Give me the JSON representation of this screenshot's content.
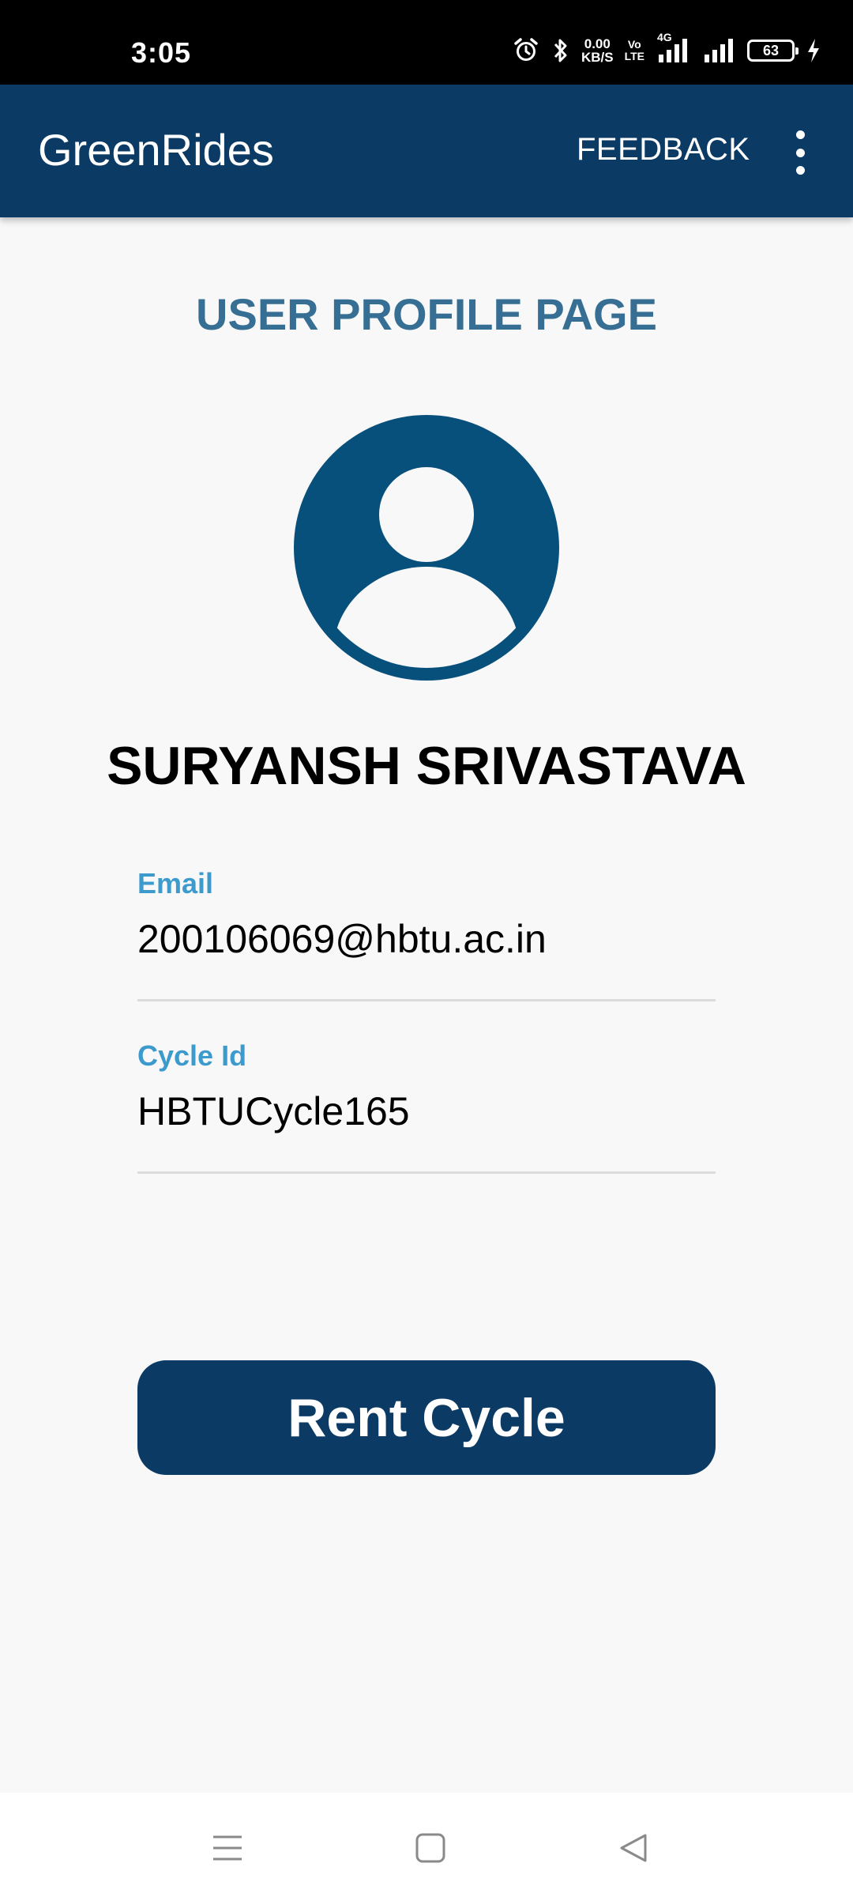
{
  "status_bar": {
    "time": "3:05",
    "net_speed_value": "0.00",
    "net_speed_unit": "KB/S",
    "volte_top": "Vo",
    "volte_bottom": "LTE",
    "network_type": "4G",
    "battery_level": "63",
    "icons": [
      "alarm-icon",
      "bluetooth-icon",
      "signal-icon",
      "signal-icon",
      "battery-icon",
      "charging-icon"
    ]
  },
  "app_bar": {
    "title": "GreenRides",
    "feedback_label": "FEEDBACK",
    "menu_icon": "more-vertical-icon",
    "color": "#0b3a64"
  },
  "profile": {
    "heading": "USER PROFILE PAGE",
    "avatar_icon": "account-circle-icon",
    "name": "SURYANSH SRIVASTAVA",
    "fields": [
      {
        "label": "Email",
        "value": "200106069@hbtu.ac.in"
      },
      {
        "label": "Cycle Id",
        "value": "HBTUCycle165"
      }
    ]
  },
  "actions": {
    "rent_label": "Rent Cycle"
  },
  "nav_bar": {
    "icons": [
      "menu-icon",
      "home-square-icon",
      "back-triangle-icon"
    ]
  },
  "colors": {
    "primary": "#0b3a64",
    "heading": "#366f93",
    "label": "#3d9acc",
    "avatar": "#08507c",
    "background": "#f8f8f9"
  }
}
